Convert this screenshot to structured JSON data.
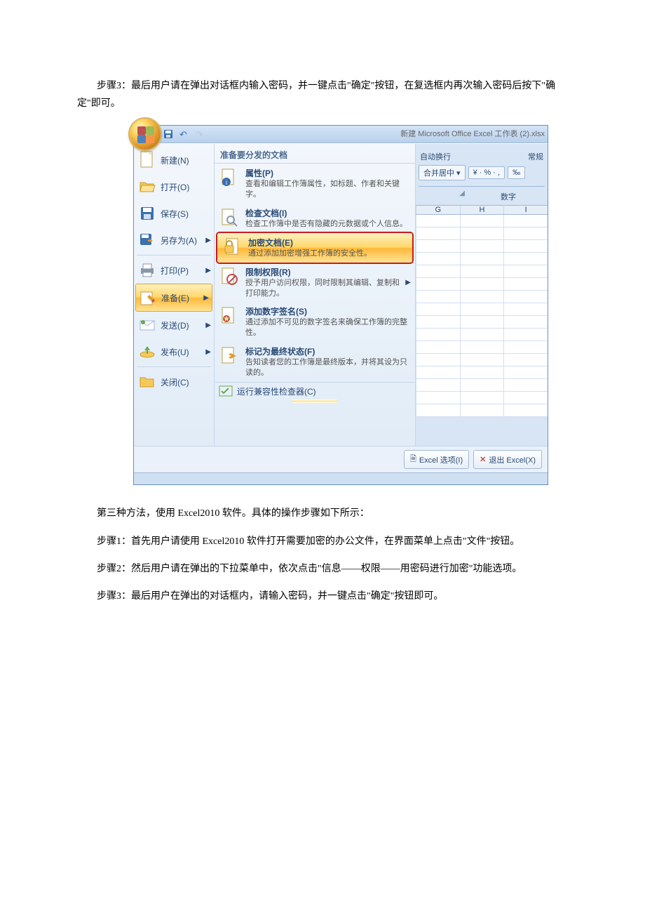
{
  "doc": {
    "p_step3_top": "步骤3：最后用户请在弹出对话框内输入密码，并一键点击\"确定\"按钮，在复选框内再次输入密码后按下\"确定\"即可。",
    "p_method3": "第三种方法，使用 Excel2010 软件。具体的操作步骤如下所示：",
    "p_step1": "步骤1：首先用户请使用 Excel2010 软件打开需要加密的办公文件，在界面菜单上点击\"文件\"按钮。",
    "p_step2": "步骤2：然后用户请在弹出的下拉菜单中，依次点击\"信息——权限——用密码进行加密\"功能选项。",
    "p_step3_bottom": "步骤3：最后用户在弹出的对话框内，请输入密码，并一键点击\"确定\"按钮即可。"
  },
  "excel": {
    "window_title": "新建 Microsoft Office Excel 工作表 (2).xlsx",
    "left_items": [
      {
        "label": "新建(N)",
        "icon": "new-doc-icon",
        "arrow": false
      },
      {
        "label": "打开(O)",
        "icon": "open-folder-icon",
        "arrow": false
      },
      {
        "label": "保存(S)",
        "icon": "save-icon",
        "arrow": false
      },
      {
        "label": "另存为(A)",
        "icon": "save-as-icon",
        "arrow": true
      },
      {
        "label": "打印(P)",
        "icon": "print-icon",
        "arrow": true
      },
      {
        "label": "准备(E)",
        "icon": "prepare-icon",
        "arrow": true,
        "active": true
      },
      {
        "label": "发送(D)",
        "icon": "send-icon",
        "arrow": true
      },
      {
        "label": "发布(U)",
        "icon": "publish-icon",
        "arrow": true
      },
      {
        "label": "关闭(C)",
        "icon": "close-folder-icon",
        "arrow": false
      }
    ],
    "mid_header": "准备要分发的文档",
    "sub_items": [
      {
        "title": "属性(P)",
        "desc": "查看和编辑工作簿属性，如标题、作者和关键字。",
        "icon": "properties-icon"
      },
      {
        "title": "检查文档(I)",
        "desc": "检查工作簿中是否有隐藏的元数据或个人信息。",
        "icon": "inspect-doc-icon"
      },
      {
        "title": "加密文档(E)",
        "desc": "通过添加加密增强工作簿的安全性。",
        "icon": "encrypt-doc-icon",
        "highlight": true
      },
      {
        "title": "限制权限(R)",
        "desc": "授予用户访问权限，同时限制其编辑、复制和打印能力。",
        "icon": "restrict-perm-icon",
        "arrow": true
      },
      {
        "title": "添加数字签名(S)",
        "desc": "通过添加不可见的数字签名来确保工作簿的完整性。",
        "icon": "digital-sign-icon"
      },
      {
        "title": "标记为最终状态(F)",
        "desc": "告知读者您的工作簿是最终版本，并将其设为只读的。",
        "icon": "mark-final-icon"
      }
    ],
    "compat_label": "运行兼容性检查器(C)",
    "footer": {
      "options": "Excel 选项(I)",
      "exit": "退出 Excel(X)"
    },
    "ribbon": {
      "wrap": "自动换行",
      "general": "常规",
      "merge": "合并居中 ▾",
      "currency": "¥ · % · ,",
      "decimal": "‰",
      "group_number": "数字",
      "cols": [
        "G",
        "H",
        "I"
      ]
    }
  }
}
